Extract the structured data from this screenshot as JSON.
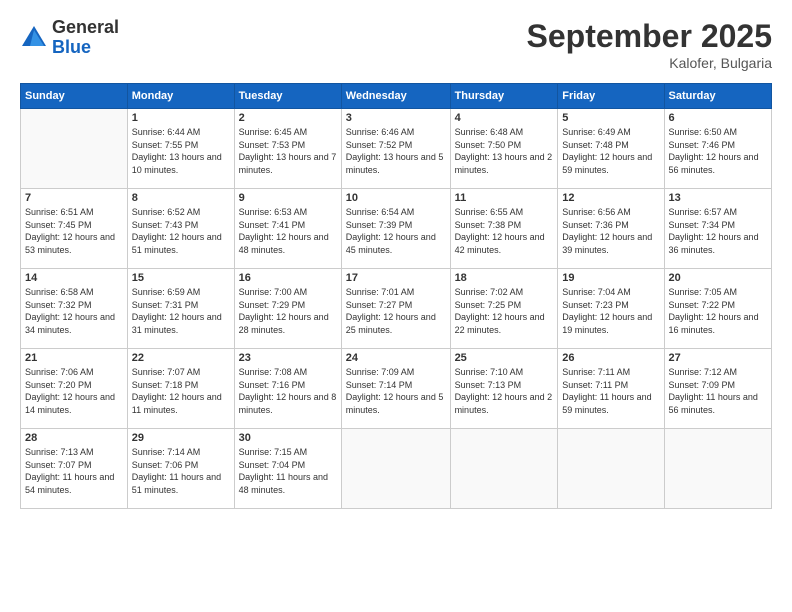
{
  "logo": {
    "general": "General",
    "blue": "Blue"
  },
  "title": "September 2025",
  "location": "Kalofer, Bulgaria",
  "days_header": [
    "Sunday",
    "Monday",
    "Tuesday",
    "Wednesday",
    "Thursday",
    "Friday",
    "Saturday"
  ],
  "weeks": [
    [
      {
        "day": "",
        "sunrise": "",
        "sunset": "",
        "daylight": ""
      },
      {
        "day": "1",
        "sunrise": "Sunrise: 6:44 AM",
        "sunset": "Sunset: 7:55 PM",
        "daylight": "Daylight: 13 hours and 10 minutes."
      },
      {
        "day": "2",
        "sunrise": "Sunrise: 6:45 AM",
        "sunset": "Sunset: 7:53 PM",
        "daylight": "Daylight: 13 hours and 7 minutes."
      },
      {
        "day": "3",
        "sunrise": "Sunrise: 6:46 AM",
        "sunset": "Sunset: 7:52 PM",
        "daylight": "Daylight: 13 hours and 5 minutes."
      },
      {
        "day": "4",
        "sunrise": "Sunrise: 6:48 AM",
        "sunset": "Sunset: 7:50 PM",
        "daylight": "Daylight: 13 hours and 2 minutes."
      },
      {
        "day": "5",
        "sunrise": "Sunrise: 6:49 AM",
        "sunset": "Sunset: 7:48 PM",
        "daylight": "Daylight: 12 hours and 59 minutes."
      },
      {
        "day": "6",
        "sunrise": "Sunrise: 6:50 AM",
        "sunset": "Sunset: 7:46 PM",
        "daylight": "Daylight: 12 hours and 56 minutes."
      }
    ],
    [
      {
        "day": "7",
        "sunrise": "Sunrise: 6:51 AM",
        "sunset": "Sunset: 7:45 PM",
        "daylight": "Daylight: 12 hours and 53 minutes."
      },
      {
        "day": "8",
        "sunrise": "Sunrise: 6:52 AM",
        "sunset": "Sunset: 7:43 PM",
        "daylight": "Daylight: 12 hours and 51 minutes."
      },
      {
        "day": "9",
        "sunrise": "Sunrise: 6:53 AM",
        "sunset": "Sunset: 7:41 PM",
        "daylight": "Daylight: 12 hours and 48 minutes."
      },
      {
        "day": "10",
        "sunrise": "Sunrise: 6:54 AM",
        "sunset": "Sunset: 7:39 PM",
        "daylight": "Daylight: 12 hours and 45 minutes."
      },
      {
        "day": "11",
        "sunrise": "Sunrise: 6:55 AM",
        "sunset": "Sunset: 7:38 PM",
        "daylight": "Daylight: 12 hours and 42 minutes."
      },
      {
        "day": "12",
        "sunrise": "Sunrise: 6:56 AM",
        "sunset": "Sunset: 7:36 PM",
        "daylight": "Daylight: 12 hours and 39 minutes."
      },
      {
        "day": "13",
        "sunrise": "Sunrise: 6:57 AM",
        "sunset": "Sunset: 7:34 PM",
        "daylight": "Daylight: 12 hours and 36 minutes."
      }
    ],
    [
      {
        "day": "14",
        "sunrise": "Sunrise: 6:58 AM",
        "sunset": "Sunset: 7:32 PM",
        "daylight": "Daylight: 12 hours and 34 minutes."
      },
      {
        "day": "15",
        "sunrise": "Sunrise: 6:59 AM",
        "sunset": "Sunset: 7:31 PM",
        "daylight": "Daylight: 12 hours and 31 minutes."
      },
      {
        "day": "16",
        "sunrise": "Sunrise: 7:00 AM",
        "sunset": "Sunset: 7:29 PM",
        "daylight": "Daylight: 12 hours and 28 minutes."
      },
      {
        "day": "17",
        "sunrise": "Sunrise: 7:01 AM",
        "sunset": "Sunset: 7:27 PM",
        "daylight": "Daylight: 12 hours and 25 minutes."
      },
      {
        "day": "18",
        "sunrise": "Sunrise: 7:02 AM",
        "sunset": "Sunset: 7:25 PM",
        "daylight": "Daylight: 12 hours and 22 minutes."
      },
      {
        "day": "19",
        "sunrise": "Sunrise: 7:04 AM",
        "sunset": "Sunset: 7:23 PM",
        "daylight": "Daylight: 12 hours and 19 minutes."
      },
      {
        "day": "20",
        "sunrise": "Sunrise: 7:05 AM",
        "sunset": "Sunset: 7:22 PM",
        "daylight": "Daylight: 12 hours and 16 minutes."
      }
    ],
    [
      {
        "day": "21",
        "sunrise": "Sunrise: 7:06 AM",
        "sunset": "Sunset: 7:20 PM",
        "daylight": "Daylight: 12 hours and 14 minutes."
      },
      {
        "day": "22",
        "sunrise": "Sunrise: 7:07 AM",
        "sunset": "Sunset: 7:18 PM",
        "daylight": "Daylight: 12 hours and 11 minutes."
      },
      {
        "day": "23",
        "sunrise": "Sunrise: 7:08 AM",
        "sunset": "Sunset: 7:16 PM",
        "daylight": "Daylight: 12 hours and 8 minutes."
      },
      {
        "day": "24",
        "sunrise": "Sunrise: 7:09 AM",
        "sunset": "Sunset: 7:14 PM",
        "daylight": "Daylight: 12 hours and 5 minutes."
      },
      {
        "day": "25",
        "sunrise": "Sunrise: 7:10 AM",
        "sunset": "Sunset: 7:13 PM",
        "daylight": "Daylight: 12 hours and 2 minutes."
      },
      {
        "day": "26",
        "sunrise": "Sunrise: 7:11 AM",
        "sunset": "Sunset: 7:11 PM",
        "daylight": "Daylight: 11 hours and 59 minutes."
      },
      {
        "day": "27",
        "sunrise": "Sunrise: 7:12 AM",
        "sunset": "Sunset: 7:09 PM",
        "daylight": "Daylight: 11 hours and 56 minutes."
      }
    ],
    [
      {
        "day": "28",
        "sunrise": "Sunrise: 7:13 AM",
        "sunset": "Sunset: 7:07 PM",
        "daylight": "Daylight: 11 hours and 54 minutes."
      },
      {
        "day": "29",
        "sunrise": "Sunrise: 7:14 AM",
        "sunset": "Sunset: 7:06 PM",
        "daylight": "Daylight: 11 hours and 51 minutes."
      },
      {
        "day": "30",
        "sunrise": "Sunrise: 7:15 AM",
        "sunset": "Sunset: 7:04 PM",
        "daylight": "Daylight: 11 hours and 48 minutes."
      },
      {
        "day": "",
        "sunrise": "",
        "sunset": "",
        "daylight": ""
      },
      {
        "day": "",
        "sunrise": "",
        "sunset": "",
        "daylight": ""
      },
      {
        "day": "",
        "sunrise": "",
        "sunset": "",
        "daylight": ""
      },
      {
        "day": "",
        "sunrise": "",
        "sunset": "",
        "daylight": ""
      }
    ]
  ]
}
